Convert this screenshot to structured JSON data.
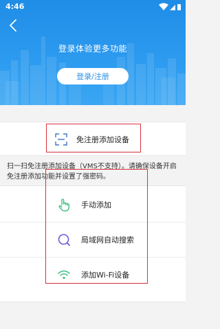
{
  "status_bar": {
    "time": "4:46"
  },
  "header": {
    "title": "登录体验更多功能",
    "login_button": "登录/注册"
  },
  "free_registration": {
    "label": "免注册添加设备",
    "description": "扫一扫免注册添加设备（VMS不支持）。请确保设备开启免注册添加功能并设置了强密码。"
  },
  "options": [
    {
      "label": "手动添加",
      "icon": "hand-pointer-icon"
    },
    {
      "label": "局域网自动搜索",
      "icon": "search-icon"
    },
    {
      "label": "添加Wi-Fi设备",
      "icon": "wifi-icon"
    }
  ],
  "colors": {
    "header_blue": "#2c9aef",
    "accent_green": "#3fbf7f",
    "search_purple": "#6b5bd6",
    "highlight_red": "#d6313a"
  }
}
